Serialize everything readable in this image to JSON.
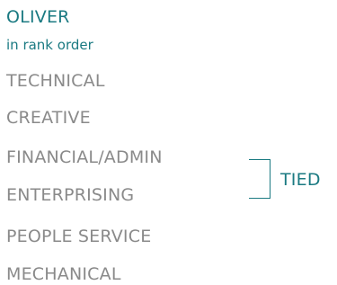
{
  "header": {
    "name": "OLIVER",
    "subtitle": "in rank order"
  },
  "ranking": {
    "items": [
      {
        "label": "TECHNICAL"
      },
      {
        "label": "CREATIVE"
      },
      {
        "label": "FINANCIAL/ADMIN"
      },
      {
        "label": "ENTERPRISING"
      },
      {
        "label": "PEOPLE SERVICE"
      },
      {
        "label": "MECHANICAL"
      }
    ],
    "tie_label": "TIED"
  },
  "colors": {
    "accent": "#1b7a82",
    "text_muted": "#8a8a8a",
    "background": "#ffffff"
  }
}
